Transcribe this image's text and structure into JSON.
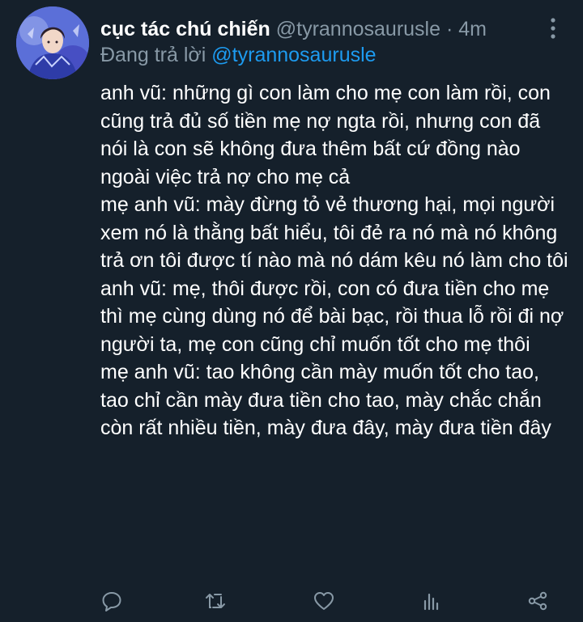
{
  "tweet": {
    "display_name": "cục tác chú chiến",
    "handle": "@tyrannosaurusle",
    "separator": "·",
    "time": "4m",
    "reply_prefix": "Đang trả lời",
    "reply_to": "@tyrannosaurusle",
    "body_lines": [
      "anh vũ: những gì con làm cho mẹ con làm rồi, con cũng trả đủ số tiền mẹ nợ ngta rồi, nhưng con đã nói là con sẽ không đưa thêm bất cứ đồng nào ngoài việc trả nợ cho mẹ cả",
      "mẹ anh vũ: mày đừng tỏ vẻ thương hại, mọi người xem nó là thằng bất hiểu, tôi đẻ ra nó mà nó không trả ơn tôi được tí nào mà nó dám kêu nó làm cho tôi",
      "anh vũ: mẹ, thôi được rồi, con có đưa tiền cho mẹ thì mẹ cùng dùng nó để bài bạc, rồi thua lỗ rồi đi nợ người ta, mẹ con cũng chỉ muốn tốt cho mẹ thôi",
      "mẹ anh vũ: tao không cần mày muốn tốt cho tao, tao chỉ cần mày đưa tiền cho tao, mày chắc chắn còn rất nhiều tiền, mày đưa đây, mày đưa tiền đây"
    ]
  },
  "icons": {
    "more": "more-vertical-icon",
    "reply": "reply-bubble-icon",
    "retweet": "retweet-icon",
    "like": "heart-icon",
    "analytics": "analytics-bars-icon",
    "share": "share-icon"
  },
  "colors": {
    "background": "#15202b",
    "text": "#ffffff",
    "muted": "#8899a6",
    "link": "#1d9bf0"
  }
}
